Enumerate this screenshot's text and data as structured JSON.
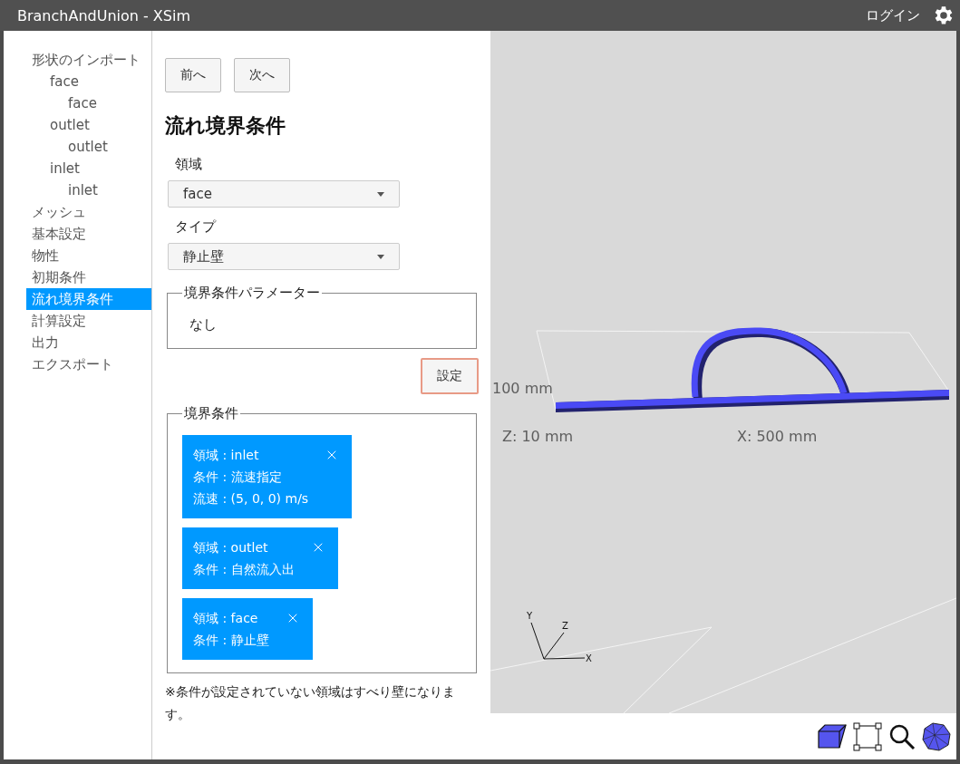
{
  "window": {
    "title": "BranchAndUnion - XSim",
    "login": "ログイン"
  },
  "sidebar": {
    "items": [
      {
        "label": "形状のインポート",
        "selected": false,
        "children": [
          {
            "label": "face",
            "selected": false,
            "children": [
              {
                "label": "face",
                "selected": false
              }
            ]
          },
          {
            "label": "outlet",
            "selected": false,
            "children": [
              {
                "label": "outlet",
                "selected": false
              }
            ]
          },
          {
            "label": "inlet",
            "selected": false,
            "children": [
              {
                "label": "inlet",
                "selected": false
              }
            ]
          }
        ]
      },
      {
        "label": "メッシュ",
        "selected": false
      },
      {
        "label": "基本設定",
        "selected": false
      },
      {
        "label": "物性",
        "selected": false
      },
      {
        "label": "初期条件",
        "selected": false
      },
      {
        "label": "流れ境界条件",
        "selected": true
      },
      {
        "label": "計算設定",
        "selected": false
      },
      {
        "label": "出力",
        "selected": false
      },
      {
        "label": "エクスポート",
        "selected": false
      }
    ]
  },
  "nav_buttons": [
    "前へ",
    "次へ"
  ],
  "heading": "流れ境界条件",
  "fields": [
    {
      "label": "領域",
      "value": "face"
    },
    {
      "label": "タイプ",
      "value": "静止壁"
    }
  ],
  "parameters": {
    "legend": "境界条件パラメーター",
    "text": "なし"
  },
  "set_button": "設定",
  "conditions": {
    "legend": "境界条件",
    "items": [
      {
        "lines": [
          "領域 : inlet",
          "条件 : 流速指定",
          "流速 : (5, 0, 0) m/s"
        ]
      },
      {
        "lines": [
          "領域 : outlet",
          "条件 : 自然流入出"
        ]
      },
      {
        "lines": [
          "領域 : face",
          "条件 : 静止壁"
        ]
      }
    ]
  },
  "note": "※条件が設定されていない領域はすべり壁になります。",
  "viewport": {
    "height_label": "100 mm",
    "z_label": "Z: 10 mm",
    "x_label": "X: 500 mm",
    "axes": [
      "Y",
      "Z",
      "X"
    ]
  }
}
